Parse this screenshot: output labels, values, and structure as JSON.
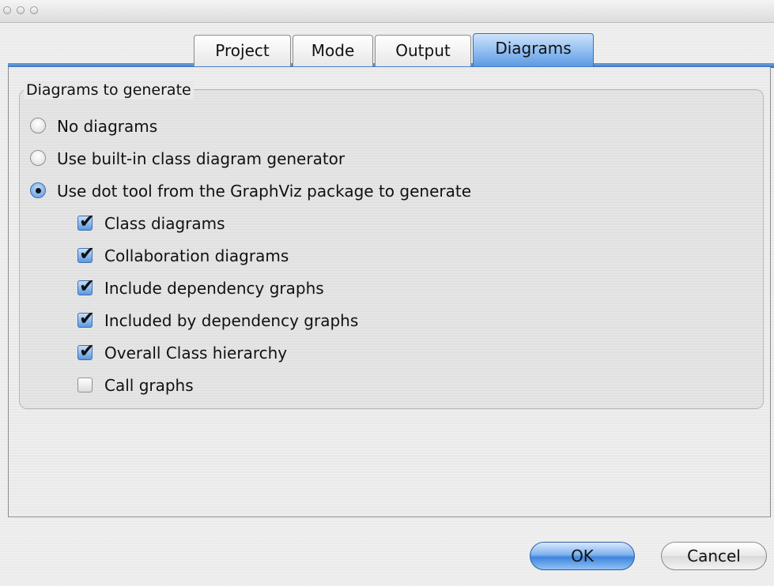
{
  "tabs": [
    {
      "label": "Project",
      "active": false
    },
    {
      "label": "Mode",
      "active": false
    },
    {
      "label": "Output",
      "active": false
    },
    {
      "label": "Diagrams",
      "active": true
    }
  ],
  "group": {
    "title": "Diagrams to generate",
    "radios": [
      {
        "label": "No diagrams",
        "selected": false
      },
      {
        "label": "Use built-in class diagram generator",
        "selected": false
      },
      {
        "label": "Use dot tool from the GraphViz package to generate",
        "selected": true
      }
    ],
    "checkboxes": [
      {
        "label": "Class diagrams",
        "checked": true
      },
      {
        "label": "Collaboration diagrams",
        "checked": true
      },
      {
        "label": "Include dependency graphs",
        "checked": true
      },
      {
        "label": "Included by dependency graphs",
        "checked": true
      },
      {
        "label": "Overall Class hierarchy",
        "checked": true
      },
      {
        "label": "Call graphs",
        "checked": false
      }
    ]
  },
  "buttons": {
    "ok": "OK",
    "cancel": "Cancel"
  },
  "colors": {
    "accent": "#5d9ae2",
    "tab_line": "#2f6bc0"
  }
}
